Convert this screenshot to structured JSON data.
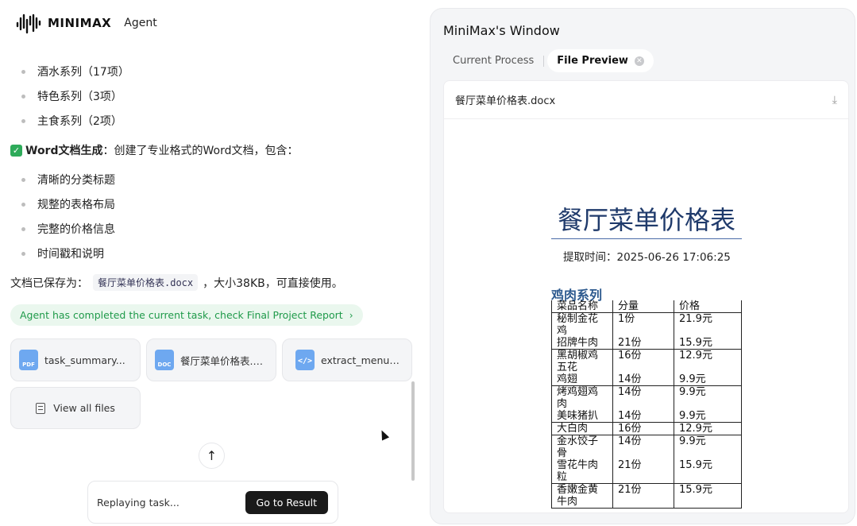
{
  "brand": {
    "name": "MINIMAX",
    "sub": "Agent"
  },
  "chat": {
    "bullets_top": [
      "酒水系列（17项）",
      "特色系列（3项）",
      "主食系列（2项）"
    ],
    "word_heading_bold": "Word文档生成",
    "word_heading_rest": "：创建了专业格式的Word文档，包含：",
    "bullets_bottom": [
      "清晰的分类标题",
      "规整的表格布局",
      "完整的价格信息",
      "时间戳和说明"
    ],
    "saved_prefix": "文档已保存为：",
    "saved_file": "餐厅菜单价格表.docx",
    "saved_suffix": "，大小38KB，可直接使用。",
    "banner": "Agent has completed the current task, check Final Project Report"
  },
  "files": [
    {
      "type": "PDF",
      "name": "task_summary..."
    },
    {
      "type": "DOC",
      "name": "餐厅菜单价格表.d..."
    },
    {
      "type": "code",
      "name": "extract_menu_..."
    }
  ],
  "view_all": "View all files",
  "replay": {
    "text": "Replaying task...",
    "button": "Go to Result"
  },
  "window": {
    "title": "MiniMax's Window",
    "tabs": [
      "Current Process",
      "File Preview"
    ],
    "preview_file": "餐厅菜单价格表.docx",
    "doc": {
      "title": "餐厅菜单价格表",
      "time": "提取时间：2025-06-26 17:06:25",
      "section": "鸡肉系列",
      "headers": [
        "菜品名称",
        "分量",
        "价格"
      ],
      "rows": [
        [
          "秘制金花\n鸡",
          "1份",
          "21.9元"
        ],
        [
          "招牌牛肉",
          "21份",
          "15.9元"
        ],
        [
          "黑胡椒鸡\n五花",
          "16份",
          "12.9元"
        ],
        [
          "鸡翅",
          "14份",
          "9.9元"
        ],
        [
          "烤鸡翅鸡\n肉",
          "14份",
          "9.9元"
        ],
        [
          "美味猪扒",
          "14份",
          "9.9元"
        ],
        [
          "大白肉",
          "16份",
          "12.9元"
        ],
        [
          "金水饺子\n骨",
          "14份",
          "9.9元"
        ],
        [
          "雪花牛肉\n粒",
          "21份",
          "15.9元"
        ],
        [
          "香嫩金黄\n牛肉",
          "21份",
          "15.9元"
        ]
      ]
    }
  }
}
